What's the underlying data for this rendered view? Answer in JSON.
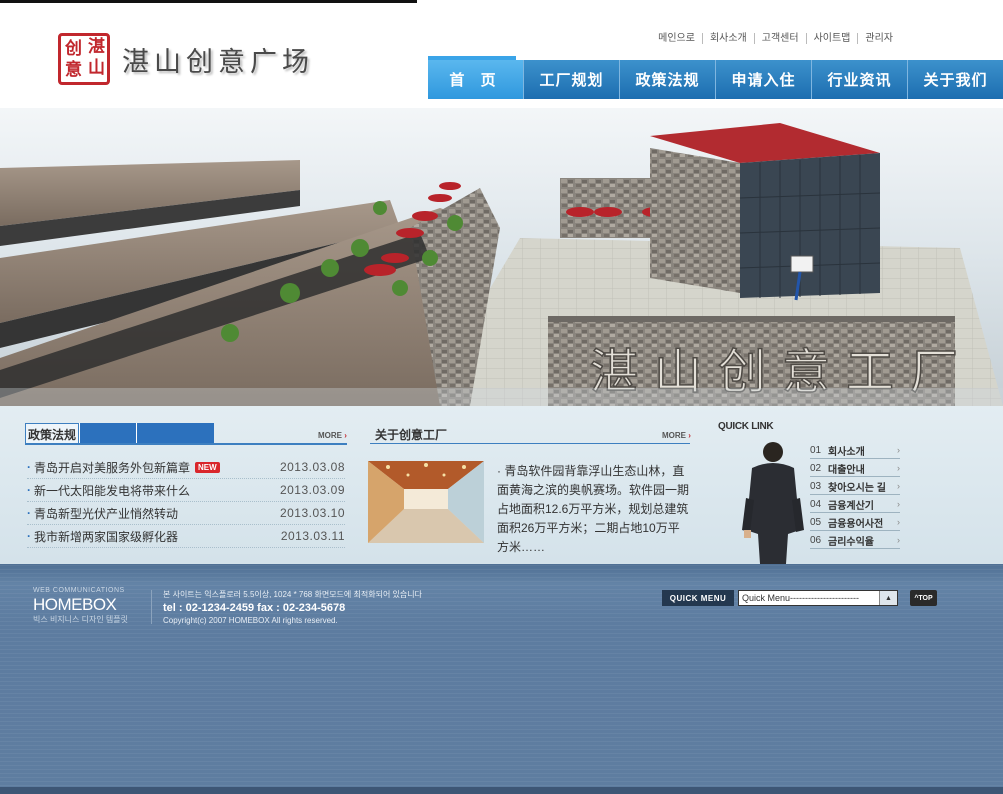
{
  "header": {
    "seal_chars": [
      "湛",
      "山",
      "创",
      "意"
    ],
    "site_title": "湛山创意广场",
    "top_links": [
      "메인으로",
      "회사소개",
      "고객센터",
      "사이트맵",
      "관리자"
    ]
  },
  "nav": [
    "首 页",
    "工厂规划",
    "政策法规",
    "申请入住",
    "行业资讯",
    "关于我们"
  ],
  "hero": {
    "wall_text": "湛山创意工厂"
  },
  "policy": {
    "tab_label": "政策法规",
    "more": "MORE",
    "items": [
      {
        "title": "青岛开启对美服务外包新篇章",
        "date": "2013.03.08",
        "badge": "NEW"
      },
      {
        "title": "新一代太阳能发电将带来什么",
        "date": "2013.03.09"
      },
      {
        "title": "青岛新型光伏产业悄然转动",
        "date": "2013.03.10"
      },
      {
        "title": "我市新增两家国家级孵化器",
        "date": "2013.03.11"
      }
    ]
  },
  "about": {
    "title": "关于创意工厂",
    "more": "MORE",
    "text": "· 青岛软件园背靠浮山生态山林，直面黄海之滨的奥帆赛场。软件园一期占地面积12.6万平方米，规划总建筑面积26万平方米；二期占地10万平方米……"
  },
  "quicklink": {
    "title": "QUICK LINK",
    "items": [
      {
        "num": "01",
        "label": "회사소개"
      },
      {
        "num": "02",
        "label": "대출안내"
      },
      {
        "num": "03",
        "label": "찾아오시는 길"
      },
      {
        "num": "04",
        "label": "금융계산기"
      },
      {
        "num": "05",
        "label": "금융용어사전"
      },
      {
        "num": "06",
        "label": "금리수익율"
      }
    ]
  },
  "footer": {
    "brand_small": "WEB COMMUNICATIONS",
    "brand": "HOMEBOX",
    "brand_sub": "빅스 비지니스 디자인 템플릿",
    "notice": "본 사이트는 익스플로러 5.5이상, 1024 * 768 화면모드에 최적화되어 있습니다",
    "contact": "tel : 02-1234-2459     fax : 02-234-5678",
    "copyright": "Copyright(c) 2007 HOMEBOX All rights reserved.",
    "quick_menu_label": "QUICK MENU",
    "quick_menu_value": "Quick Menu-----------------------",
    "top_label": "TOP"
  },
  "colors": {
    "nav_blue": "#1d6eb0",
    "nav_active": "#3aa4e8",
    "accent_red": "#c1272d",
    "footer_blue": "#5e7da0"
  }
}
